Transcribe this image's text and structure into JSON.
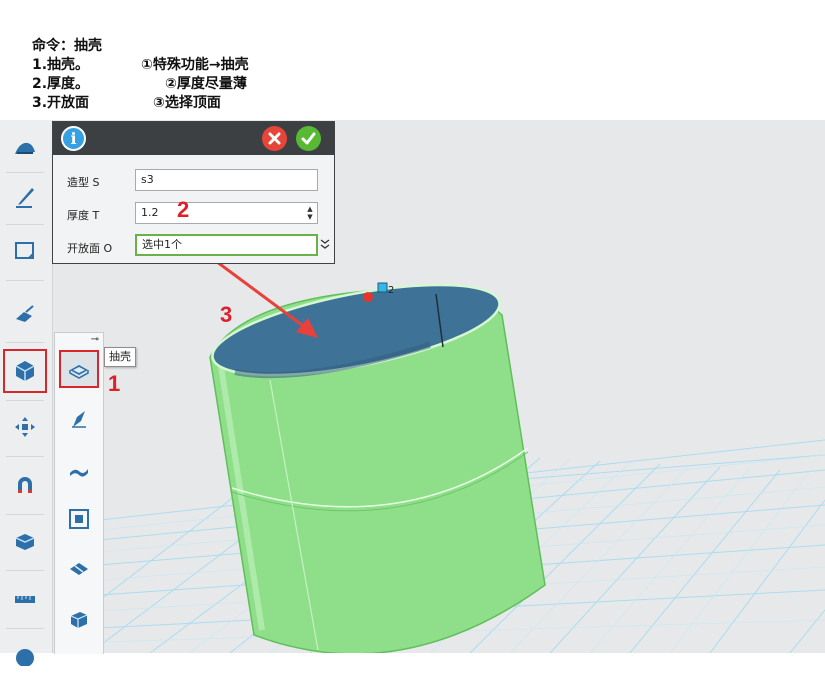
{
  "instructions": {
    "title": "命令：抽壳",
    "steps": [
      {
        "num": "1.抽壳。",
        "action": "①特殊功能→抽壳"
      },
      {
        "num": "2.厚度。",
        "action": "②厚度尽量薄"
      },
      {
        "num": "3.开放面",
        "action": "③选择顶面"
      }
    ]
  },
  "dialog": {
    "fields": [
      {
        "label": "造型 S",
        "value": "s3"
      },
      {
        "label": "厚度 T",
        "value": "1.2"
      },
      {
        "label": "开放面 O",
        "value": "选中1个"
      }
    ]
  },
  "tooltip": "抽壳",
  "callouts": [
    "1",
    "2",
    "3"
  ],
  "colors": {
    "callout_red": "#dc2228",
    "model_green": "#8fdf8a",
    "shell_inner_blue": "#3d6f93",
    "grid_line": "#9fd8ef",
    "dialog_header": "#3d4043"
  },
  "toolbar_icons": [
    "basic-shapes-icon",
    "sketch-pen-icon",
    "sketch-rect-icon",
    "edit-icon",
    "special-functions-icon",
    "move-icon",
    "magnet-icon",
    "combine-icon",
    "measure-icon",
    "render-icon"
  ],
  "subpanel_icons": [
    "shell-icon",
    "twist-icon",
    "bend-icon",
    "stamp-icon",
    "split-icon",
    "solid-icon"
  ]
}
